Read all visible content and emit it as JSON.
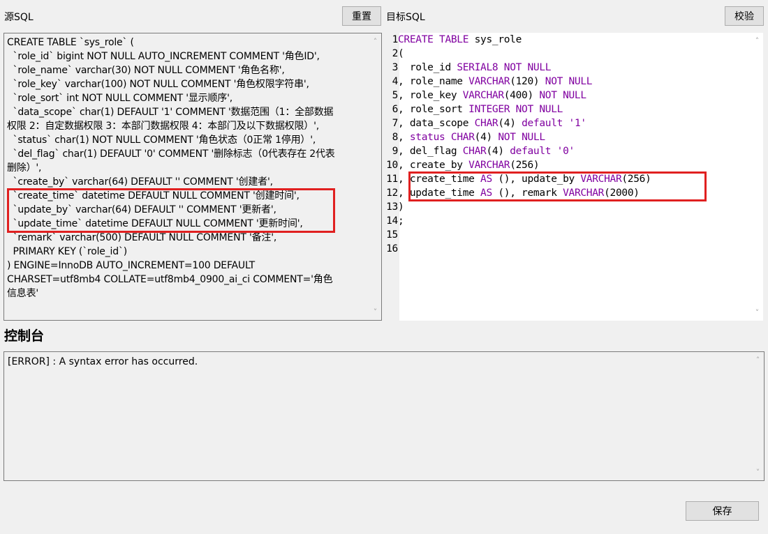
{
  "source": {
    "label": "源SQL",
    "reset_label": "重置",
    "lines": [
      "CREATE TABLE `sys_role` (",
      "  `role_id` bigint NOT NULL AUTO_INCREMENT COMMENT '角色ID',",
      "  `role_name` varchar(30) NOT NULL COMMENT '角色名称',",
      "  `role_key` varchar(100) NOT NULL COMMENT '角色权限字符串',",
      "  `role_sort` int NOT NULL COMMENT '显示顺序',",
      "  `data_scope` char(1) DEFAULT '1' COMMENT '数据范围（1：全部数据",
      "权限 2：自定数据权限 3：本部门数据权限 4：本部门及以下数据权限）',",
      "  `status` char(1) NOT NULL COMMENT '角色状态（0正常 1停用）',",
      "  `del_flag` char(1) DEFAULT '0' COMMENT '删除标志（0代表存在 2代表",
      "删除）',",
      "  `create_by` varchar(64) DEFAULT '' COMMENT '创建者',",
      "  `create_time` datetime DEFAULT NULL COMMENT '创建时间',",
      "  `update_by` varchar(64) DEFAULT '' COMMENT '更新者',",
      "  `update_time` datetime DEFAULT NULL COMMENT '更新时间',",
      "  `remark` varchar(500) DEFAULT NULL COMMENT '备注',",
      "  PRIMARY KEY (`role_id`)",
      ") ENGINE=InnoDB AUTO_INCREMENT=100 DEFAULT",
      "CHARSET=utf8mb4 COLLATE=utf8mb4_0900_ai_ci COMMENT='角色",
      "信息表'"
    ]
  },
  "target": {
    "label": "目标SQL",
    "verify_label": "校验",
    "lines": [
      {
        "num": "1",
        "tokens": [
          [
            "kw",
            "CREATE TABLE"
          ],
          [
            "plain",
            " sys_role"
          ]
        ]
      },
      {
        "num": "2",
        "tokens": [
          [
            "plain",
            "("
          ]
        ]
      },
      {
        "num": "3",
        "tokens": [
          [
            "plain",
            "  role_id "
          ],
          [
            "ty",
            "SERIAL8"
          ],
          [
            "plain",
            " "
          ],
          [
            "kw",
            "NOT NULL"
          ]
        ]
      },
      {
        "num": "4",
        "tokens": [
          [
            "plain",
            ", role_name "
          ],
          [
            "ty",
            "VARCHAR"
          ],
          [
            "plain",
            "(120) "
          ],
          [
            "kw",
            "NOT NULL"
          ]
        ]
      },
      {
        "num": "5",
        "tokens": [
          [
            "plain",
            ", role_key "
          ],
          [
            "ty",
            "VARCHAR"
          ],
          [
            "plain",
            "(400) "
          ],
          [
            "kw",
            "NOT NULL"
          ]
        ]
      },
      {
        "num": "6",
        "tokens": [
          [
            "plain",
            ", role_sort "
          ],
          [
            "ty",
            "INTEGER"
          ],
          [
            "plain",
            " "
          ],
          [
            "kw",
            "NOT NULL"
          ]
        ]
      },
      {
        "num": "7",
        "tokens": [
          [
            "plain",
            ", data_scope "
          ],
          [
            "ty",
            "CHAR"
          ],
          [
            "plain",
            "(4) "
          ],
          [
            "kw",
            "default"
          ],
          [
            "plain",
            " "
          ],
          [
            "str",
            "'1'"
          ]
        ]
      },
      {
        "num": "8",
        "tokens": [
          [
            "plain",
            ", "
          ],
          [
            "kw",
            "status"
          ],
          [
            "plain",
            " "
          ],
          [
            "ty",
            "CHAR"
          ],
          [
            "plain",
            "(4) "
          ],
          [
            "kw",
            "NOT NULL"
          ]
        ]
      },
      {
        "num": "9",
        "tokens": [
          [
            "plain",
            ", del_flag "
          ],
          [
            "ty",
            "CHAR"
          ],
          [
            "plain",
            "(4) "
          ],
          [
            "kw",
            "default"
          ],
          [
            "plain",
            " "
          ],
          [
            "str",
            "'0'"
          ]
        ]
      },
      {
        "num": "10",
        "tokens": [
          [
            "plain",
            ", create_by "
          ],
          [
            "ty",
            "VARCHAR"
          ],
          [
            "plain",
            "(256)"
          ]
        ]
      },
      {
        "num": "11",
        "tokens": [
          [
            "plain",
            ", create_time "
          ],
          [
            "kw",
            "AS"
          ],
          [
            "plain",
            " (), update_by "
          ],
          [
            "ty",
            "VARCHAR"
          ],
          [
            "plain",
            "(256)"
          ]
        ]
      },
      {
        "num": "12",
        "tokens": [
          [
            "plain",
            ", update_time "
          ],
          [
            "kw",
            "AS"
          ],
          [
            "plain",
            " (), remark "
          ],
          [
            "ty",
            "VARCHAR"
          ],
          [
            "plain",
            "(2000)"
          ]
        ]
      },
      {
        "num": "13",
        "tokens": [
          [
            "plain",
            ")"
          ]
        ]
      },
      {
        "num": "14",
        "tokens": [
          [
            "plain",
            ";"
          ]
        ]
      },
      {
        "num": "15",
        "tokens": []
      },
      {
        "num": "16",
        "tokens": []
      }
    ]
  },
  "console": {
    "title": "控制台",
    "message": "[ERROR] : A syntax error has occurred."
  },
  "save_label": "保存",
  "colors": {
    "highlight": "#e02020",
    "keyword": "#8000a0"
  }
}
